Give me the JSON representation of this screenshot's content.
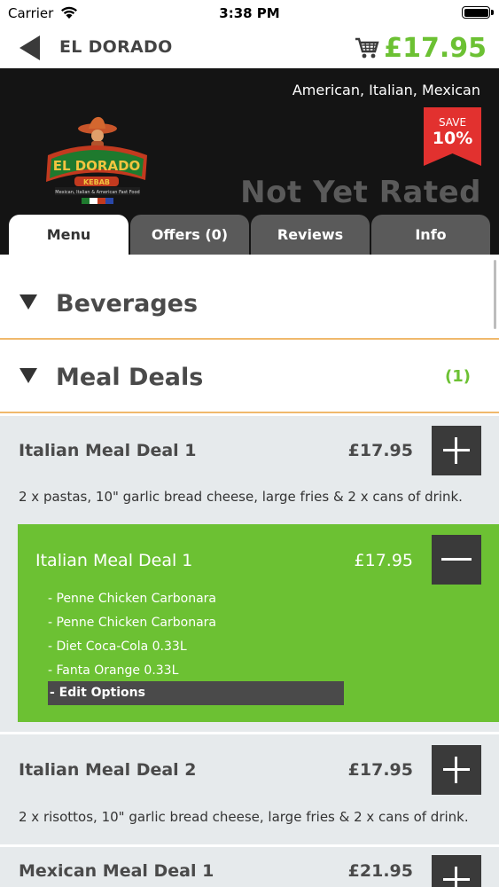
{
  "status_bar": {
    "carrier": "Carrier",
    "time": "3:38 PM"
  },
  "nav": {
    "title": "EL DORADO",
    "cart_total": "£17.95",
    "back_icon": "back-arrow-icon",
    "cart_icon": "cart-icon"
  },
  "header": {
    "cuisines": "American, Italian, Mexican",
    "save_label": "SAVE",
    "save_percent": "10%",
    "rating_text": "Not Yet Rated",
    "logo_text": "EL DORADO",
    "logo_subtitle": "Mexican, Italian & American Fast Food"
  },
  "tabs": [
    {
      "label": "Menu",
      "active": true
    },
    {
      "label": "Offers (0)",
      "active": false
    },
    {
      "label": "Reviews",
      "active": false
    },
    {
      "label": "Info",
      "active": false
    }
  ],
  "categories": [
    {
      "name": "Beverages",
      "count": ""
    },
    {
      "name": "Meal Deals",
      "count": "(1)"
    }
  ],
  "items": [
    {
      "name": "Italian Meal Deal 1",
      "price": "£17.95",
      "description": "2 x pastas, 10\" garlic bread cheese, large fries & 2 x cans of drink."
    },
    {
      "name": "Italian Meal Deal 2",
      "price": "£17.95",
      "description": "2 x risottos, 10\" garlic bread cheese, large fries & 2 x cans of drink."
    },
    {
      "name": "Mexican Meal Deal 1",
      "price": "£21.95",
      "description": ""
    }
  ],
  "selected_item": {
    "name": "Italian Meal Deal 1",
    "price": "£17.95",
    "options": [
      "- Penne Chicken Carbonara",
      "- Penne Chicken Carbonara",
      "- Diet Coca-Cola 0.33L",
      "- Fanta Orange 0.33L"
    ],
    "edit_label": "- Edit Options"
  },
  "colors": {
    "accent_green": "#6cc133",
    "dark": "#141414",
    "save_red": "#e2312f",
    "divider_orange": "#f0b96c"
  }
}
